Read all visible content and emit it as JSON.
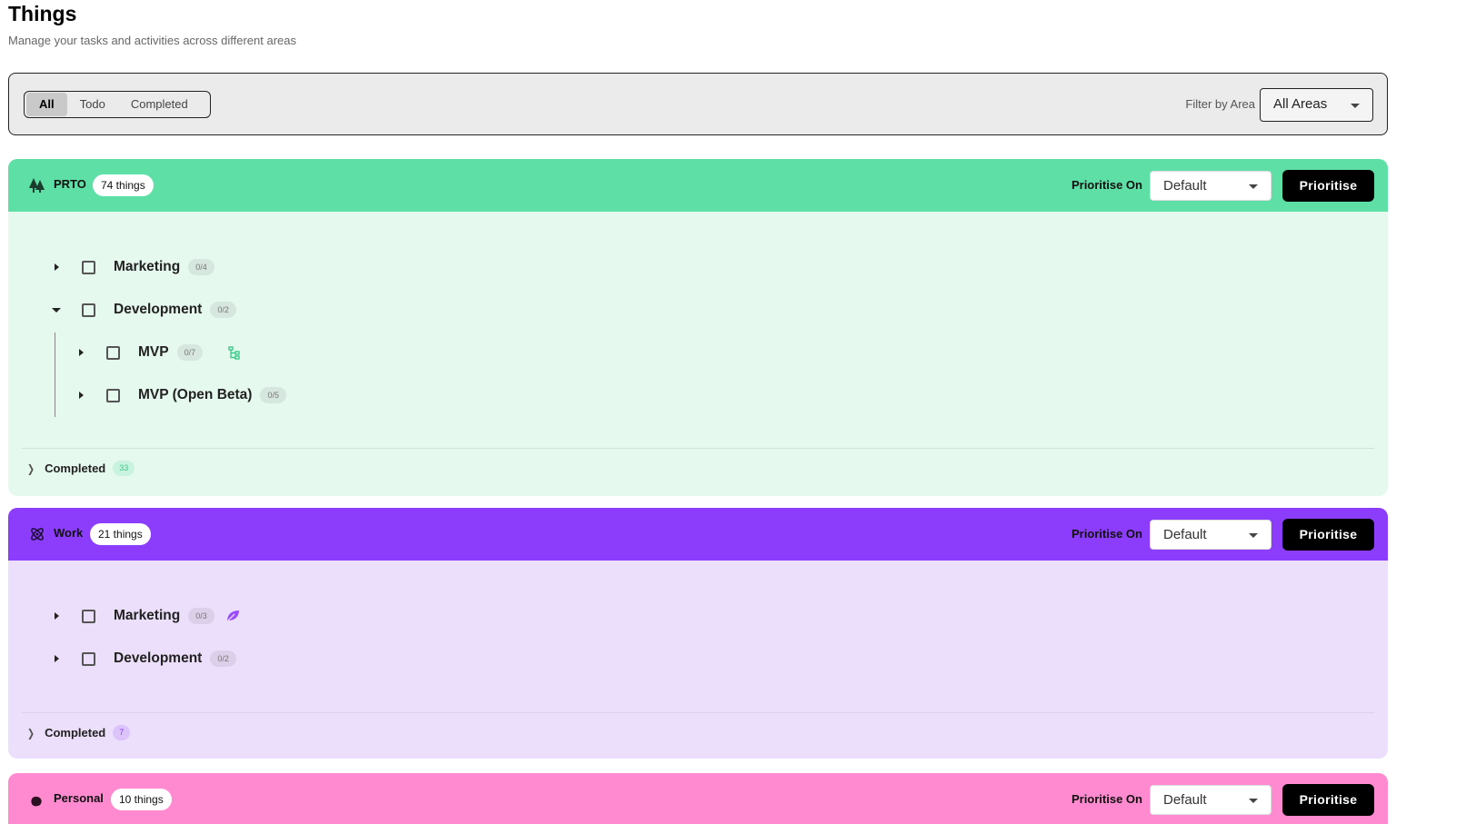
{
  "page": {
    "title": "Things",
    "subtitle": "Manage your tasks and activities across different areas"
  },
  "filters": {
    "tabs": [
      "All",
      "Todo",
      "Completed"
    ],
    "active_tab": "All",
    "area_label": "Filter by Area",
    "area_value": "All Areas"
  },
  "areas": [
    {
      "name": "PRTO",
      "count_label": "74 things",
      "icon": "tree-icon",
      "header_color": "#5ddfa6",
      "body_color": "#e6f9ef",
      "prioritise_label": "Prioritise On",
      "prioritise_value": "Default",
      "prioritise_button": "Prioritise",
      "items": [
        {
          "label": "Marketing",
          "progress": "0/4",
          "expanded": false
        },
        {
          "label": "Development",
          "progress": "0/2",
          "expanded": true,
          "children": [
            {
              "label": "MVP",
              "progress": "0/7",
              "expanded": false,
              "icon": "hierarchy-icon"
            },
            {
              "label": "MVP (Open Beta)",
              "progress": "0/5",
              "expanded": false
            }
          ]
        }
      ],
      "completed_label": "Completed",
      "completed_count": "33",
      "completed_count_color": "#5ddfa6"
    },
    {
      "name": "Work",
      "count_label": "21 things",
      "icon": "atom-icon",
      "header_color": "#8c3cfb",
      "body_color": "#ecdffc",
      "prioritise_label": "Prioritise On",
      "prioritise_value": "Default",
      "prioritise_button": "Prioritise",
      "items": [
        {
          "label": "Marketing",
          "progress": "0/3",
          "expanded": false,
          "icon": "leaf-icon"
        },
        {
          "label": "Development",
          "progress": "0/2",
          "expanded": false
        }
      ],
      "completed_label": "Completed",
      "completed_count": "7",
      "completed_count_color": "#8c3cfb"
    },
    {
      "name": "Personal",
      "count_label": "10 things",
      "icon": "blob-icon",
      "header_color": "#ff8ad0",
      "prioritise_label": "Prioritise On",
      "prioritise_value": "Default",
      "prioritise_button": "Prioritise"
    }
  ]
}
